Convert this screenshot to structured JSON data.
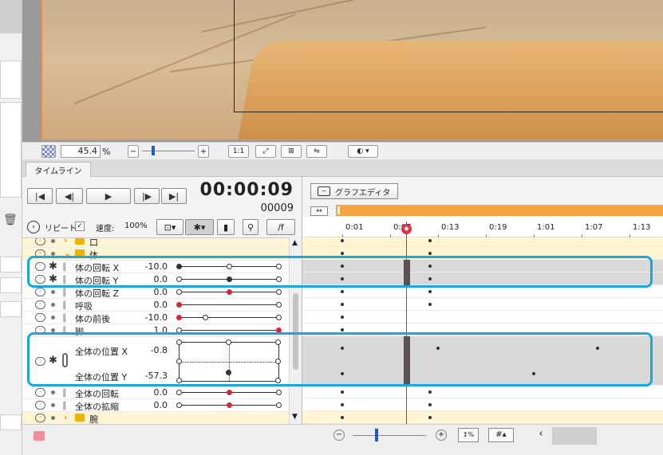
{
  "preview": {
    "zoom_value": "45.4",
    "zoom_unit": "%",
    "fit_label": "1:1"
  },
  "timeline": {
    "tab_label": "タイムライン",
    "timecode": "00:00:09",
    "frame": "00009",
    "repeat_label": "リピート",
    "speed_label": "速度:",
    "speed_value": "100%",
    "perframe_label": "/f",
    "graph_editor_label": "グラフエディタ",
    "ruler_ticks": [
      "0:01",
      "0:07",
      "0:13",
      "0:19",
      "1:01",
      "1:07",
      "1:13"
    ]
  },
  "params": [
    {
      "name": "口",
      "type": "folder",
      "value": ""
    },
    {
      "name": "体",
      "type": "folder-open",
      "value": ""
    },
    {
      "name": "体の回転 X",
      "value": "-10.0"
    },
    {
      "name": "体の回転 Y",
      "value": "0.0"
    },
    {
      "name": "体の回転 Z",
      "value": "0.0"
    },
    {
      "name": "呼吸",
      "value": "0.0"
    },
    {
      "name": "体の前後",
      "value": "-10.0"
    },
    {
      "name": "脚",
      "value": "1.0"
    },
    {
      "name": "全体の位置 X",
      "value": "-0.8"
    },
    {
      "name": "全体の位置 Y",
      "value": "-57.3"
    },
    {
      "name": "全体の回転",
      "value": "0.0"
    },
    {
      "name": "全体の拡縮",
      "value": "0.0"
    },
    {
      "name": "腕",
      "type": "folder",
      "value": ""
    }
  ],
  "colors": {
    "highlight": "#1aa7e0",
    "playhead": "#e6304a",
    "range_bar": "#f5a640",
    "folder": "#f0b400"
  },
  "icons": [
    "zoom-out-icon",
    "zoom-in-icon",
    "fit-icon",
    "flip-icon",
    "first-frame-icon",
    "prev-frame-icon",
    "play-icon",
    "next-frame-icon",
    "last-frame-icon",
    "repeat-icon",
    "keyframe-icon",
    "graph-editor-icon",
    "trash-icon"
  ]
}
